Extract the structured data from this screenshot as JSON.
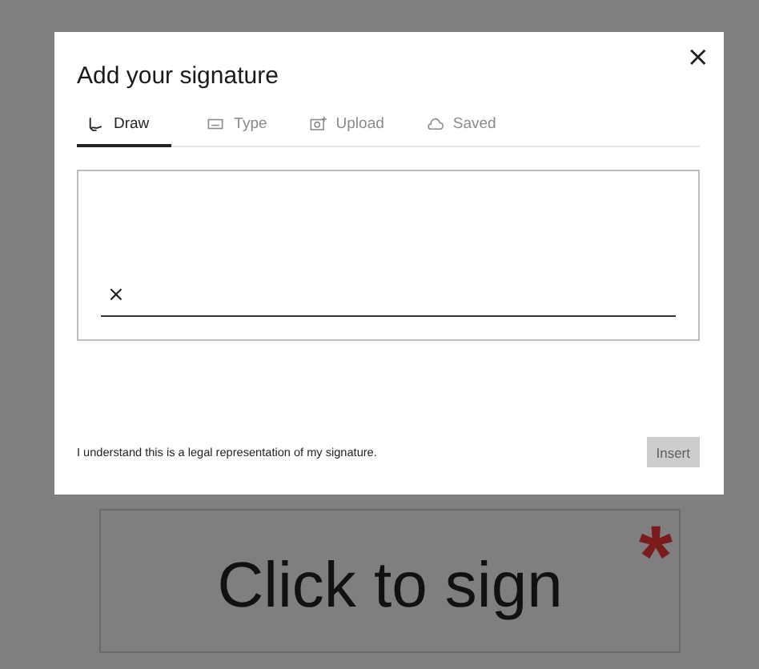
{
  "page": {
    "sign_field": {
      "label": "Click to sign",
      "required_mark": "*"
    }
  },
  "dialog": {
    "title": "Add your signature",
    "close": "×",
    "tabs": [
      {
        "kind": "draw",
        "label": "Draw",
        "selected": true
      },
      {
        "kind": "type",
        "label": "Type",
        "selected": false
      },
      {
        "kind": "upload",
        "label": "Upload",
        "selected": false
      },
      {
        "kind": "saved",
        "label": "Saved",
        "selected": false
      }
    ],
    "pad": {
      "clear": "×"
    },
    "disclaimer": "I understand this is a legal representation of my signature.",
    "insert_button": {
      "label": "Insert",
      "disabled": true
    }
  }
}
